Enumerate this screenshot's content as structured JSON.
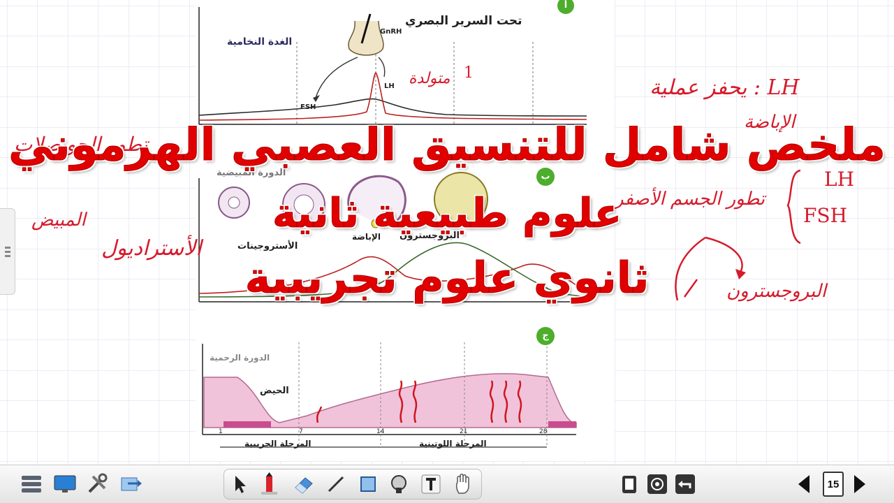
{
  "title": {
    "line1": "ملخص شامل للتنسيق العصبي الهرموني",
    "line2": "علوم طبيعية ثانية",
    "line3": "ثانوي علوم تجريبية"
  },
  "figure": {
    "panel_a_badge": "أ",
    "panel_b_badge": "ب",
    "panel_c_badge": "ج",
    "hypothalamus": "تحت السرير البصري",
    "pituitary": "الغدة النخامية",
    "gnrh": "GnRH",
    "fsh": "FSH",
    "lh": "LH",
    "ovarian_cycle": "الدورة المبيضية",
    "ovulation": "الإباضة",
    "estrogens": "الأستروجينات",
    "progesterone": "البروجسترون",
    "uterine_cycle": "الدورة الرحمية",
    "menstruation": "الحيض",
    "follicular_phase": "المرحلة الجريبية",
    "luteal_phase": "المرحلة اللوتينية",
    "day_ticks": [
      "1",
      "7",
      "14",
      "21",
      "28"
    ]
  },
  "annotations": {
    "lh_role": "LH : يحفز عملية",
    "ovulation_note": "الإباضة",
    "lh2": "LH",
    "fsh2": "FSH",
    "corpus_luteum": "تطور الجسم الأصفر",
    "peak": "متولدة",
    "follicles": "تطور الحويصلات",
    "ovary": "المبيض",
    "estradiol": "الأستراديول",
    "progesterone_note": "البروجسترون",
    "mark": "1"
  },
  "toolbar": {
    "page_number": "15"
  },
  "colors": {
    "title_red": "#e10000",
    "annotation_red": "#d51b2b",
    "grid_line": "#d9d9ef",
    "badge_green": "#4cae2b"
  }
}
